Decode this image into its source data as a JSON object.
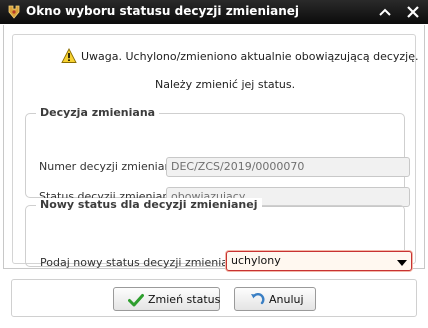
{
  "window": {
    "title": "Okno wyboru statusu decyzji zmienianej",
    "icons": {
      "app": "app-logo-icon",
      "collapse": "chevron-up-icon",
      "close": "close-icon"
    }
  },
  "message": {
    "warning": "Uwaga. Uchylono/zmieniono aktualnie obowiązującą decyzję.",
    "info": "Należy zmienić jej status.",
    "icon": "warning-icon"
  },
  "group_changed": {
    "title": "Decyzja zmieniana",
    "decision_number_label": "Numer decyzji zmienianej:",
    "decision_number_value": "DEC/ZCS/2019/0000070",
    "decision_status_label": "Status decyzji zmienianej:",
    "decision_status_value": "obowiązujący"
  },
  "group_new": {
    "title": "Nowy status dla decyzji zmienianej",
    "prompt_label": "Podaj nowy status decyzji zmienianej:",
    "selected_value": "uchylony"
  },
  "buttons": {
    "change_status": "Zmień status",
    "cancel": "Anuluj"
  },
  "colors": {
    "titlebar": "#111111",
    "select_border": "#c83232",
    "check_green": "#2e9e2e",
    "cancel_blue": "#3a7fc4"
  }
}
